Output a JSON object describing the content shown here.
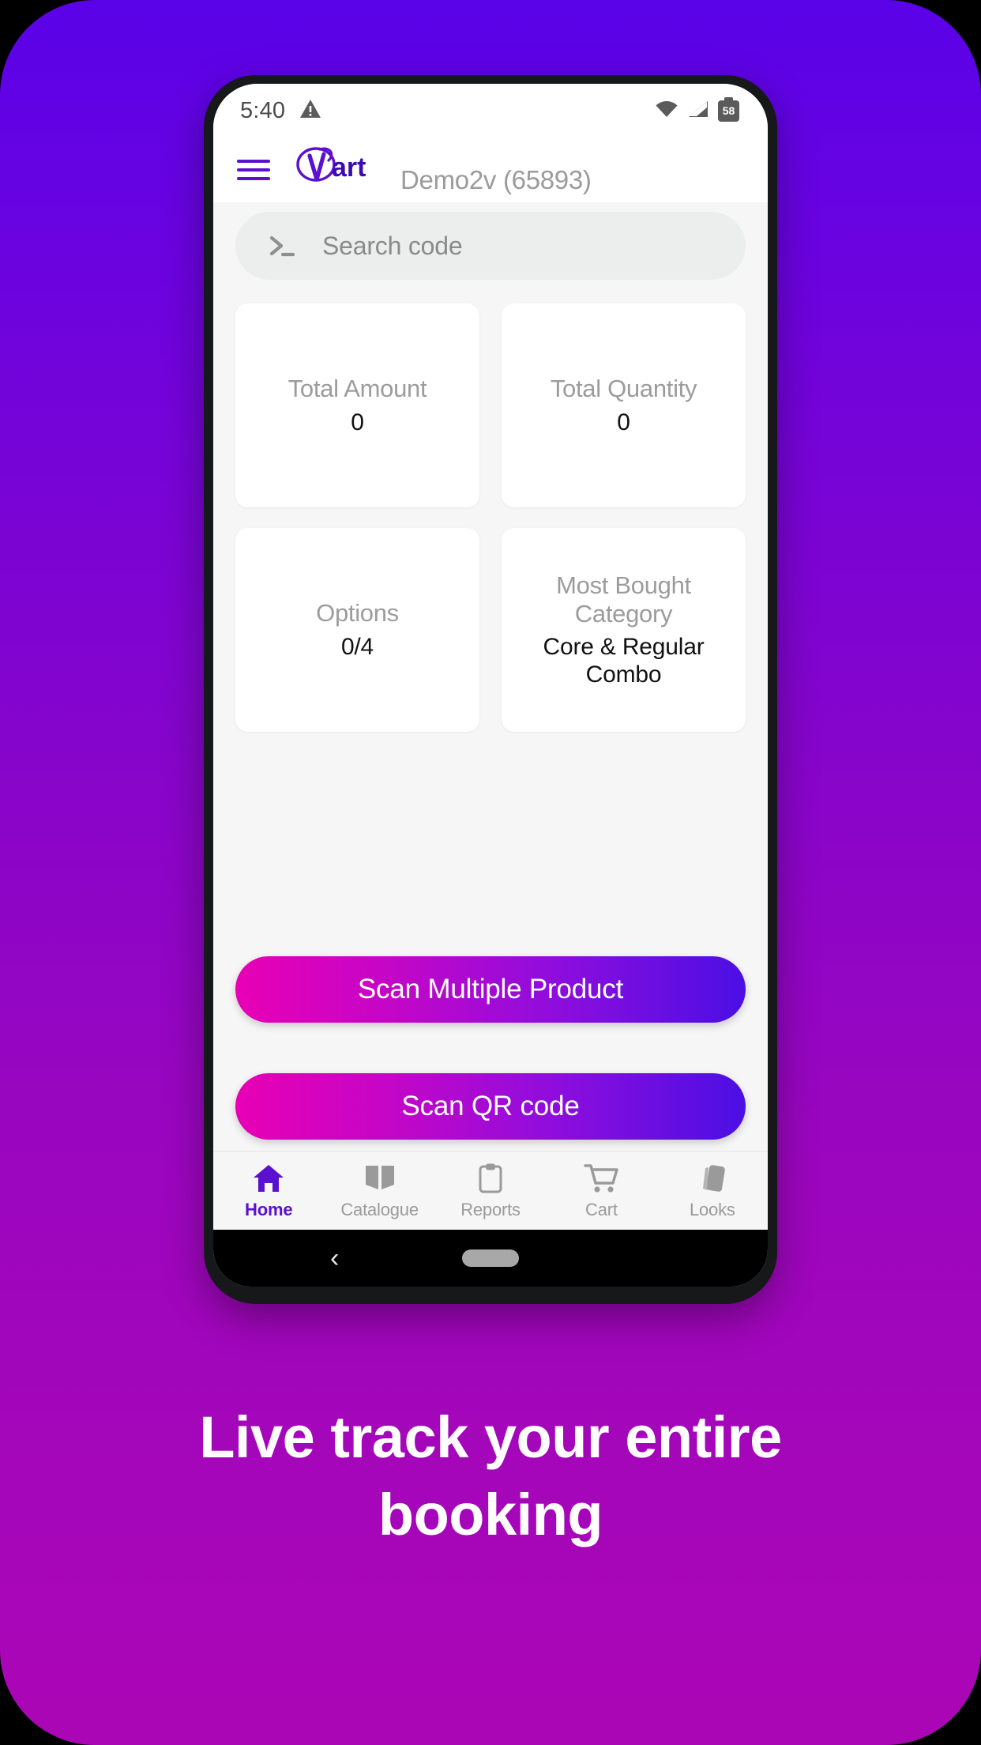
{
  "promo": {
    "caption": "Live track your entire booking",
    "background_top": "#5a02e8",
    "background_bottom": "#ab06b6"
  },
  "statusbar": {
    "time": "5:40",
    "warning_icon": "warning-triangle-icon",
    "wifi_icon": "wifi-icon",
    "signal_icon": "cellular-signal-icon",
    "battery_level": "58"
  },
  "appbar": {
    "menu_icon": "hamburger-menu-icon",
    "brand_name": "Qart",
    "account_label": "Demo2v (65893)",
    "brand_color": "#5b10cf"
  },
  "search": {
    "icon": "terminal-prompt-icon",
    "placeholder": "Search code",
    "value": ""
  },
  "cards": [
    {
      "title": "Total Amount",
      "value": "0",
      "name": "total-amount-card"
    },
    {
      "title": "Total Quantity",
      "value": "0",
      "name": "total-quantity-card"
    },
    {
      "title": "Options",
      "value": "0/4",
      "name": "options-card"
    },
    {
      "title": "Most Bought Category",
      "value": "Core & Regular Combo",
      "name": "most-bought-category-card"
    }
  ],
  "actions": {
    "scan_multiple_label": "Scan Multiple Product",
    "scan_qr_label": "Scan QR code",
    "gradient_start": "#e800b4",
    "gradient_end": "#4b0fe4"
  },
  "bottomnav": {
    "active": "Home",
    "active_color": "#5b10cf",
    "inactive_color": "#9a9a9a",
    "items": [
      {
        "label": "Home",
        "icon": "home-icon"
      },
      {
        "label": "Catalogue",
        "icon": "book-icon"
      },
      {
        "label": "Reports",
        "icon": "clipboard-icon"
      },
      {
        "label": "Cart",
        "icon": "shopping-cart-icon"
      },
      {
        "label": "Looks",
        "icon": "swatch-card-icon"
      }
    ]
  },
  "gesturebar": {
    "back_glyph": "‹",
    "back_icon": "back-chevron-icon",
    "home_icon": "home-pill-icon"
  }
}
